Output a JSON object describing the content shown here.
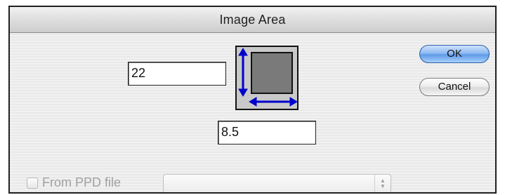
{
  "window": {
    "title": "Image Area"
  },
  "fields": {
    "height_value": "22",
    "width_value": "8.5"
  },
  "buttons": {
    "ok_label": "OK",
    "cancel_label": "Cancel"
  },
  "ppd": {
    "checkbox_label": "From PPD file",
    "checked": false,
    "popup_value": "",
    "enabled": false
  },
  "diagram": {
    "arrow_color": "#0000cc",
    "icons": [
      "vertical-arrow-icon",
      "horizontal-arrow-icon"
    ]
  }
}
